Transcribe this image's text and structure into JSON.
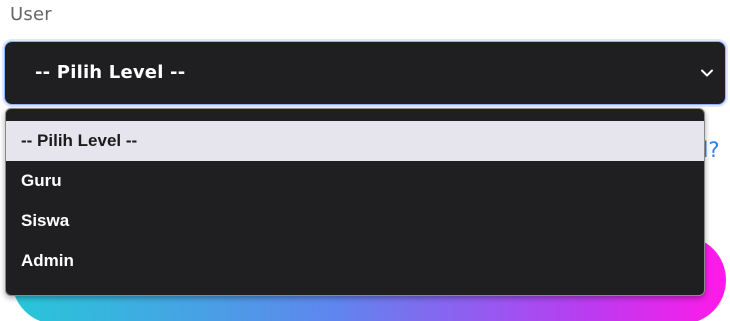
{
  "form": {
    "label": "User",
    "select": {
      "selected_label": "-- Pilih Level --",
      "chevron_icon": "chevron-down-icon"
    },
    "partial_link_text": "d?",
    "options": [
      {
        "label": "-- Pilih Level --",
        "selected": true
      },
      {
        "label": "Guru",
        "selected": false
      },
      {
        "label": "Siswa",
        "selected": false
      },
      {
        "label": "Admin",
        "selected": false
      }
    ]
  },
  "colors": {
    "select_bg": "#1f1f21",
    "select_border": "#8fb1ff",
    "option_highlight_bg": "#e6e4ec",
    "link": "#2f7df0",
    "button_gradient": [
      "#27c7d8",
      "#5f86ee",
      "#b93df2",
      "#ff19e8"
    ]
  }
}
